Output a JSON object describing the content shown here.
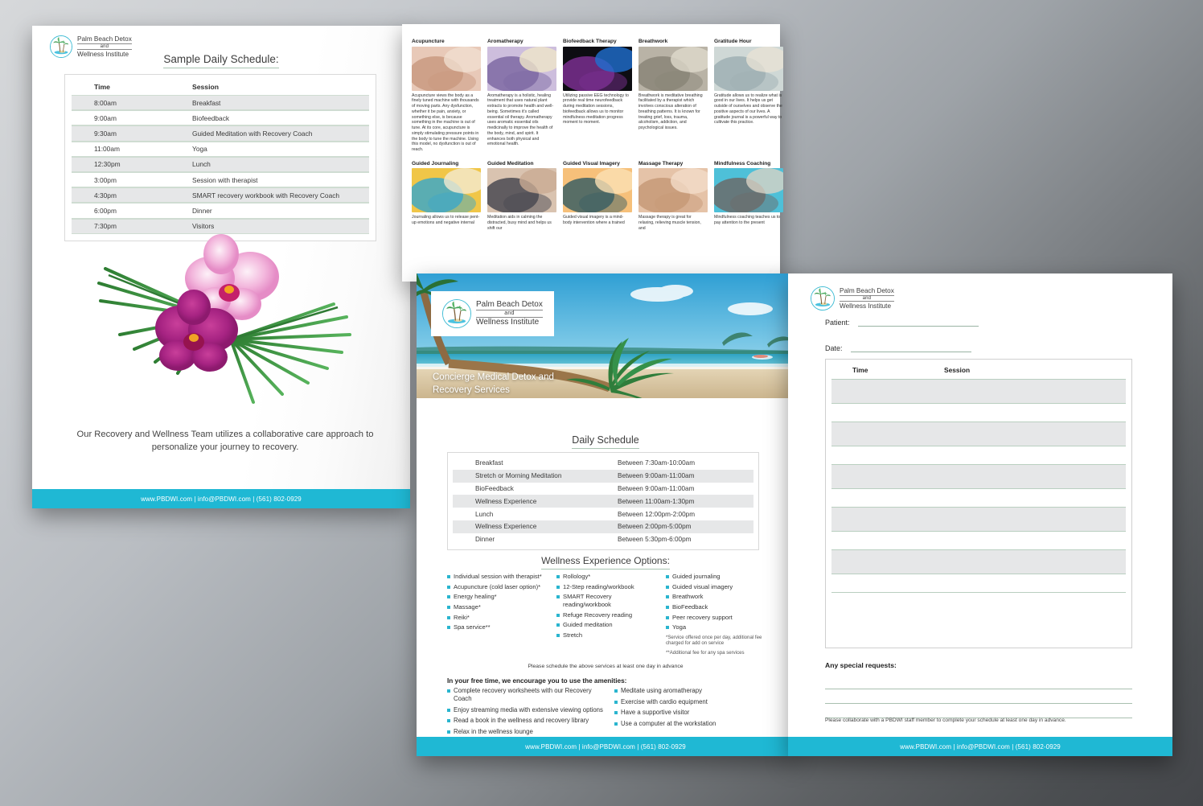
{
  "brand": {
    "line1": "Palm Beach Detox",
    "line2": "and",
    "line3": "Wellness Institute",
    "accent": "#1fb8d4",
    "rule_green": "#a9c4b2"
  },
  "footer": {
    "text": "www.PBDWI.com | info@PBDWI.com | (561) 802-0929"
  },
  "page1": {
    "title": "Sample Daily Schedule:",
    "columns": {
      "time": "Time",
      "session": "Session"
    },
    "rows": [
      {
        "time": "8:00am",
        "session": "Breakfast"
      },
      {
        "time": "9:00am",
        "session": "Biofeedback"
      },
      {
        "time": "9:30am",
        "session": "Guided Meditation with Recovery Coach"
      },
      {
        "time": "11:00am",
        "session": "Yoga"
      },
      {
        "time": "12:30pm",
        "session": "Lunch"
      },
      {
        "time": "3:00pm",
        "session": "Session with therapist"
      },
      {
        "time": "4:30pm",
        "session": "SMART recovery workbook with Recovery Coach"
      },
      {
        "time": "6:00pm",
        "session": "Dinner"
      },
      {
        "time": "7:30pm",
        "session": "Visitors"
      }
    ],
    "tagline": "Our Recovery and Wellness Team utilizes a collaborative care approach to personalize your journey to recovery.",
    "artwork": "orchid-palm-leaf-image"
  },
  "page2": {
    "therapies": [
      {
        "title": "Acupuncture",
        "image": "acupuncture-photo",
        "desc": "Acupuncture views the body as a finely tuned machine with thousands of moving parts. Any dysfunction, whether it be pain, anxiety, or something else, is because something in the machine is out of tune. At its core, acupuncture is simply stimulating pressure points in the body to tune the machine. Using this model, no dysfunction is out of reach."
      },
      {
        "title": "Aromatherapy",
        "image": "lavender-oils-photo",
        "desc": "Aromatherapy is a holistic, healing treatment that uses natural plant extracts to promote health and well-being. Sometimes it's called essential oil therapy. Aromatherapy uses aromatic essential oils medicinally to improve the health of the body, mind, and spirit. It enhances both physical and emotional health."
      },
      {
        "title": "Biofeedback Therapy",
        "image": "brain-scan-photo",
        "desc": "Utilizing passive EEG technology to provide real time neurofeedback during meditation sessions, biofeedback allows us to monitor mindfulness meditation progress moment to moment."
      },
      {
        "title": "Breathwork",
        "image": "beach-meditation-photo",
        "desc": "Breathwork is meditative breathing facilitated by a therapist which involves conscious alteration of breathing patterns. It is known for treating grief, loss, trauma, alcoholism, addiction, and psychological issues."
      },
      {
        "title": "Gratitude Hour",
        "image": "arms-raised-beach-photo",
        "desc": "Gratitude allows us to realize what is good in our lives. It helps us get outside of ourselves and observe the positive aspects of our lives. A gratitude journal is a powerful way to cultivate this practice."
      },
      {
        "title": "Guided Journaling",
        "image": "journal-writing-photo",
        "desc": "Journaling allows us to release pent-up emotions and negative internal"
      },
      {
        "title": "Guided Meditation",
        "image": "group-meditation-photo",
        "desc": "Meditation aids in calming the distracted, busy mind and helps us shift our"
      },
      {
        "title": "Guided Visual Imagery",
        "image": "sunset-dock-photo",
        "desc": "Guided visual imagery is a mind-body intervention where a trained"
      },
      {
        "title": "Massage Therapy",
        "image": "back-massage-photo",
        "desc": "Massage therapy is great for relaxing, relieving muscle tension, and"
      },
      {
        "title": "Mindfulness Coaching",
        "image": "zen-stones-beach-photo",
        "desc": "Mindfulness coaching teaches us to pay attention to the present"
      }
    ]
  },
  "page3": {
    "hero_image": "tropical-beach-palm-tree-photo",
    "hero_caption": "Concierge Medical Detox and Recovery Services",
    "schedule_title": "Daily Schedule",
    "schedule": [
      {
        "activity": "Breakfast",
        "time": "Between 7:30am-10:00am"
      },
      {
        "activity": "Stretch or Morning Meditation",
        "time": "Between 9:00am-11:00am"
      },
      {
        "activity": "BioFeedback",
        "time": "Between 9:00am-11:00am"
      },
      {
        "activity": "Wellness Experience",
        "time": "Between 11:00am-1:30pm"
      },
      {
        "activity": "Lunch",
        "time": "Between 12:00pm-2:00pm"
      },
      {
        "activity": "Wellness Experience",
        "time": "Between 2:00pm-5:00pm"
      },
      {
        "activity": "Dinner",
        "time": "Between 5:30pm-6:00pm"
      }
    ],
    "options_title": "Wellness Experience Options:",
    "options_col1": [
      "Individual session with therapist*",
      "Acupuncture (cold laser option)*",
      "Energy healing*",
      "Massage*",
      "Reiki*",
      "Spa service**"
    ],
    "options_col2": [
      "Rollology*",
      "12-Step reading/workbook",
      "SMART Recovery reading/workbook",
      "Refuge Recovery reading",
      "Guided meditation",
      "Stretch"
    ],
    "options_col3": [
      "Guided journaling",
      "Guided visual imagery",
      "Breathwork",
      "BioFeedback",
      "Peer recovery support",
      "Yoga"
    ],
    "note1": "*Service offered once per day, additional fee charged for add on service",
    "note2": "**Additional fee for any spa services",
    "advance_note": "Please schedule the above services at least one day in advance",
    "free_time_heading": "In your free time, we encourage you to use the amenities:",
    "free_time_col1": [
      "Complete recovery worksheets with our Recovery Coach",
      "Enjoy streaming media with extensive viewing options",
      "Read a book in the wellness and recovery library",
      "Relax in the wellness lounge"
    ],
    "free_time_col2": [
      "Meditate using aromatherapy",
      "Exercise with cardio equipment",
      "Have a supportive visitor",
      "Use a computer at the workstation"
    ]
  },
  "page4": {
    "patient_label": "Patient:",
    "date_label": "Date:",
    "columns": {
      "time": "Time",
      "session": "Session"
    },
    "blank_rows": 5,
    "special_requests_label": "Any special requests:",
    "note": "Please collaborate with a PBDWI staff member to complete your schedule at least one day in advance."
  }
}
